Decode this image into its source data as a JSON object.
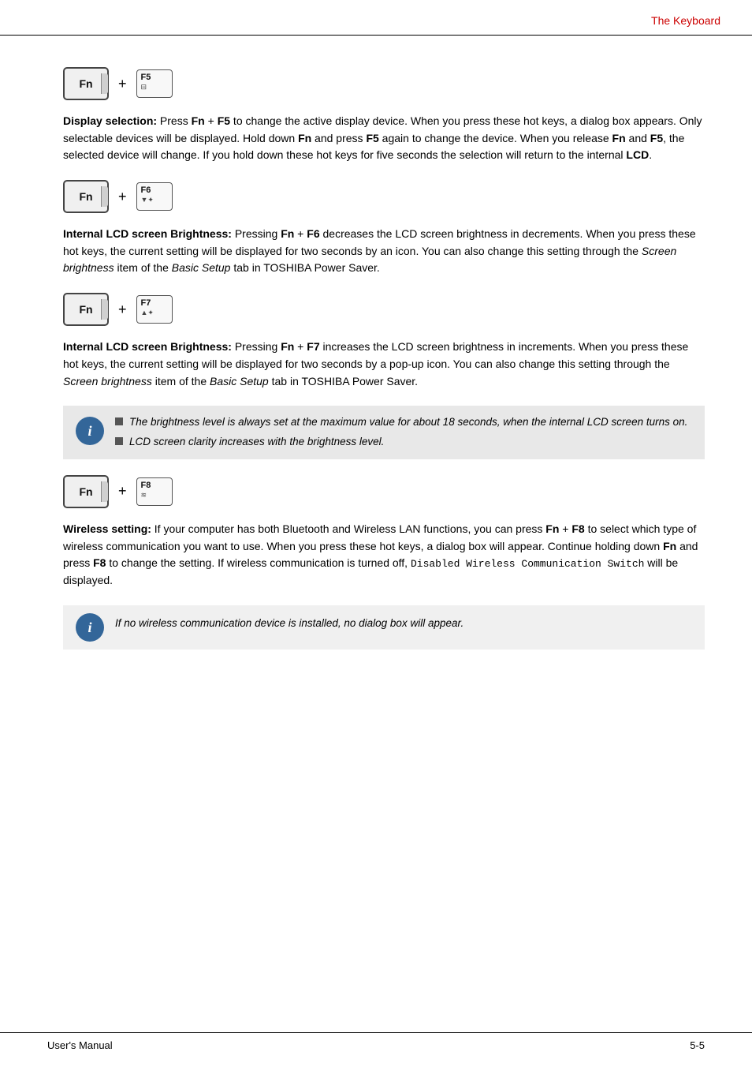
{
  "header": {
    "title": "The Keyboard"
  },
  "footer": {
    "left": "User's Manual",
    "right": "5-5"
  },
  "sections": [
    {
      "id": "display-selection",
      "key_combo": [
        "Fn",
        "F5"
      ],
      "f5_icon": "⊟",
      "title": "Display selection:",
      "text": " Press Fn + F5 to change the active display device. When you press these hot keys, a dialog box appears. Only selectable devices will be displayed. Hold down Fn and press F5 again to change the device. When you release Fn and F5, the selected device will change. If you hold down these hot keys for five seconds the selection will return to the internal LCD."
    },
    {
      "id": "brightness-decrease",
      "key_combo": [
        "Fn",
        "F6"
      ],
      "f6_icon": "▼☼",
      "title": "Internal LCD screen Brightness:",
      "text": " Pressing Fn + F6 decreases the LCD screen brightness in decrements. When you press these hot keys, the current setting will be displayed for two seconds by an icon. You can also change this setting through the Screen brightness item of the Basic Setup tab in TOSHIBA Power Saver."
    },
    {
      "id": "brightness-increase",
      "key_combo": [
        "Fn",
        "F7"
      ],
      "f7_icon": "▲☼",
      "title": "Internal LCD screen Brightness:",
      "text": " Pressing Fn + F7 increases the LCD screen brightness in increments. When you press these hot keys, the current setting will be displayed for two seconds by a pop-up icon. You can also change this setting through the Screen brightness item of the Basic Setup tab in TOSHIBA Power Saver."
    },
    {
      "id": "wireless",
      "key_combo": [
        "Fn",
        "F8"
      ],
      "f8_icon": "~",
      "title": "Wireless setting:",
      "text": " If your computer has both Bluetooth and Wireless LAN functions, you can press Fn + F8 to select which type of wireless communication you want to use. When you press these hot keys, a dialog box will appear. Continue holding down Fn and press F8 to change the setting. If wireless communication is turned off, Disabled Wireless Communication Switch will be displayed."
    }
  ],
  "info_box": {
    "icon_label": "i",
    "items": [
      "The brightness level is always set at the maximum value for about 18 seconds, when the internal LCD screen turns on.",
      "LCD screen clarity increases with the brightness level."
    ]
  },
  "info_single": {
    "icon_label": "i",
    "text": "If no wireless communication device is installed, no dialog box will appear."
  },
  "keys": {
    "fn_label": "Fn",
    "f5_label": "F5",
    "f6_label": "F6",
    "f7_label": "F7",
    "f8_label": "F8",
    "plus": "+"
  }
}
